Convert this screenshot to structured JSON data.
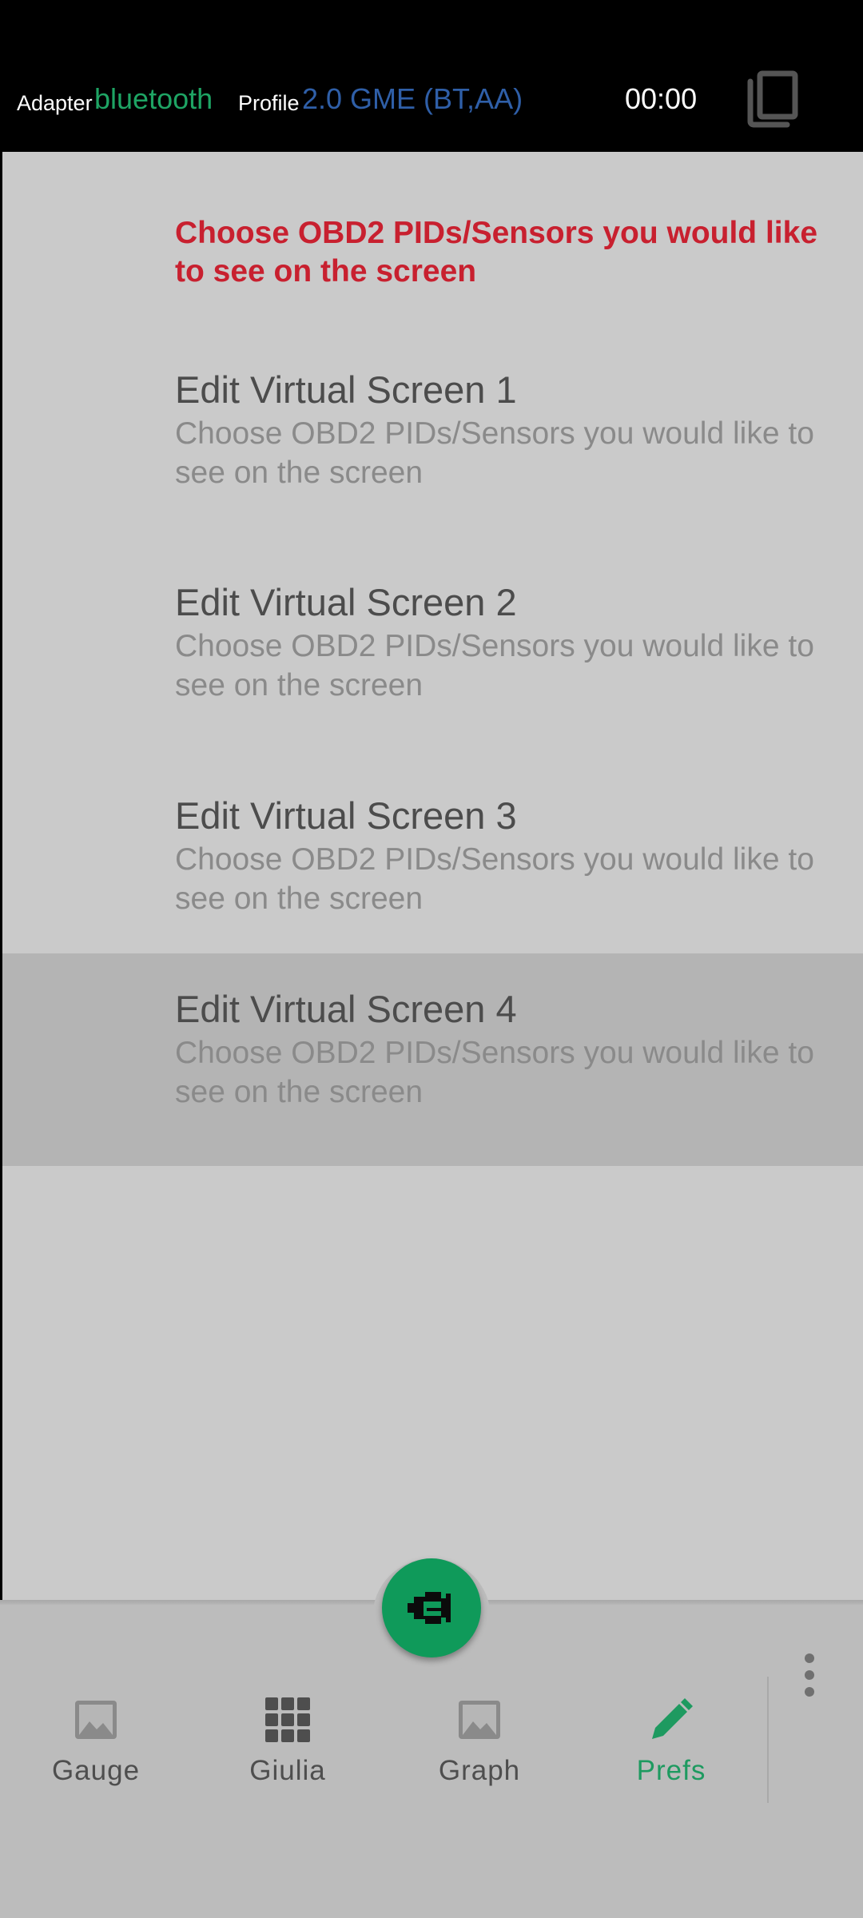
{
  "header": {
    "adapter_label": "Adapter",
    "adapter_value": "bluetooth",
    "profile_label": "Profile",
    "profile_value": "2.0 GME (BT,AA)",
    "timer": "00:00"
  },
  "prefs": {
    "note": "Choose OBD2 PIDs/Sensors you would like to see on the screen",
    "items": [
      {
        "title": "Edit Virtual Screen 1",
        "summary": "Choose OBD2 PIDs/Sensors you would like to see on the screen"
      },
      {
        "title": "Edit Virtual Screen 2",
        "summary": "Choose OBD2 PIDs/Sensors you would like to see on the screen"
      },
      {
        "title": "Edit Virtual Screen 3",
        "summary": "Choose OBD2 PIDs/Sensors you would like to see on the screen"
      },
      {
        "title": "Edit Virtual Screen 4",
        "summary": "Choose OBD2 PIDs/Sensors you would like to see on the screen"
      }
    ]
  },
  "nav": {
    "items": [
      {
        "label": "Gauge",
        "icon": "image-icon"
      },
      {
        "label": "Giulia",
        "icon": "grid-icon"
      },
      {
        "label": "Graph",
        "icon": "image-icon"
      },
      {
        "label": "Prefs",
        "icon": "pencil-icon"
      }
    ],
    "active": "Prefs"
  },
  "colors": {
    "adapter_value": "#1ea464",
    "profile_value": "#2f5fa8",
    "note": "#c8202f",
    "fab": "#0f9a5a",
    "nav_active": "#1e9a60",
    "selected_row": "#b4b4b4",
    "list_background": "#cacaca"
  }
}
